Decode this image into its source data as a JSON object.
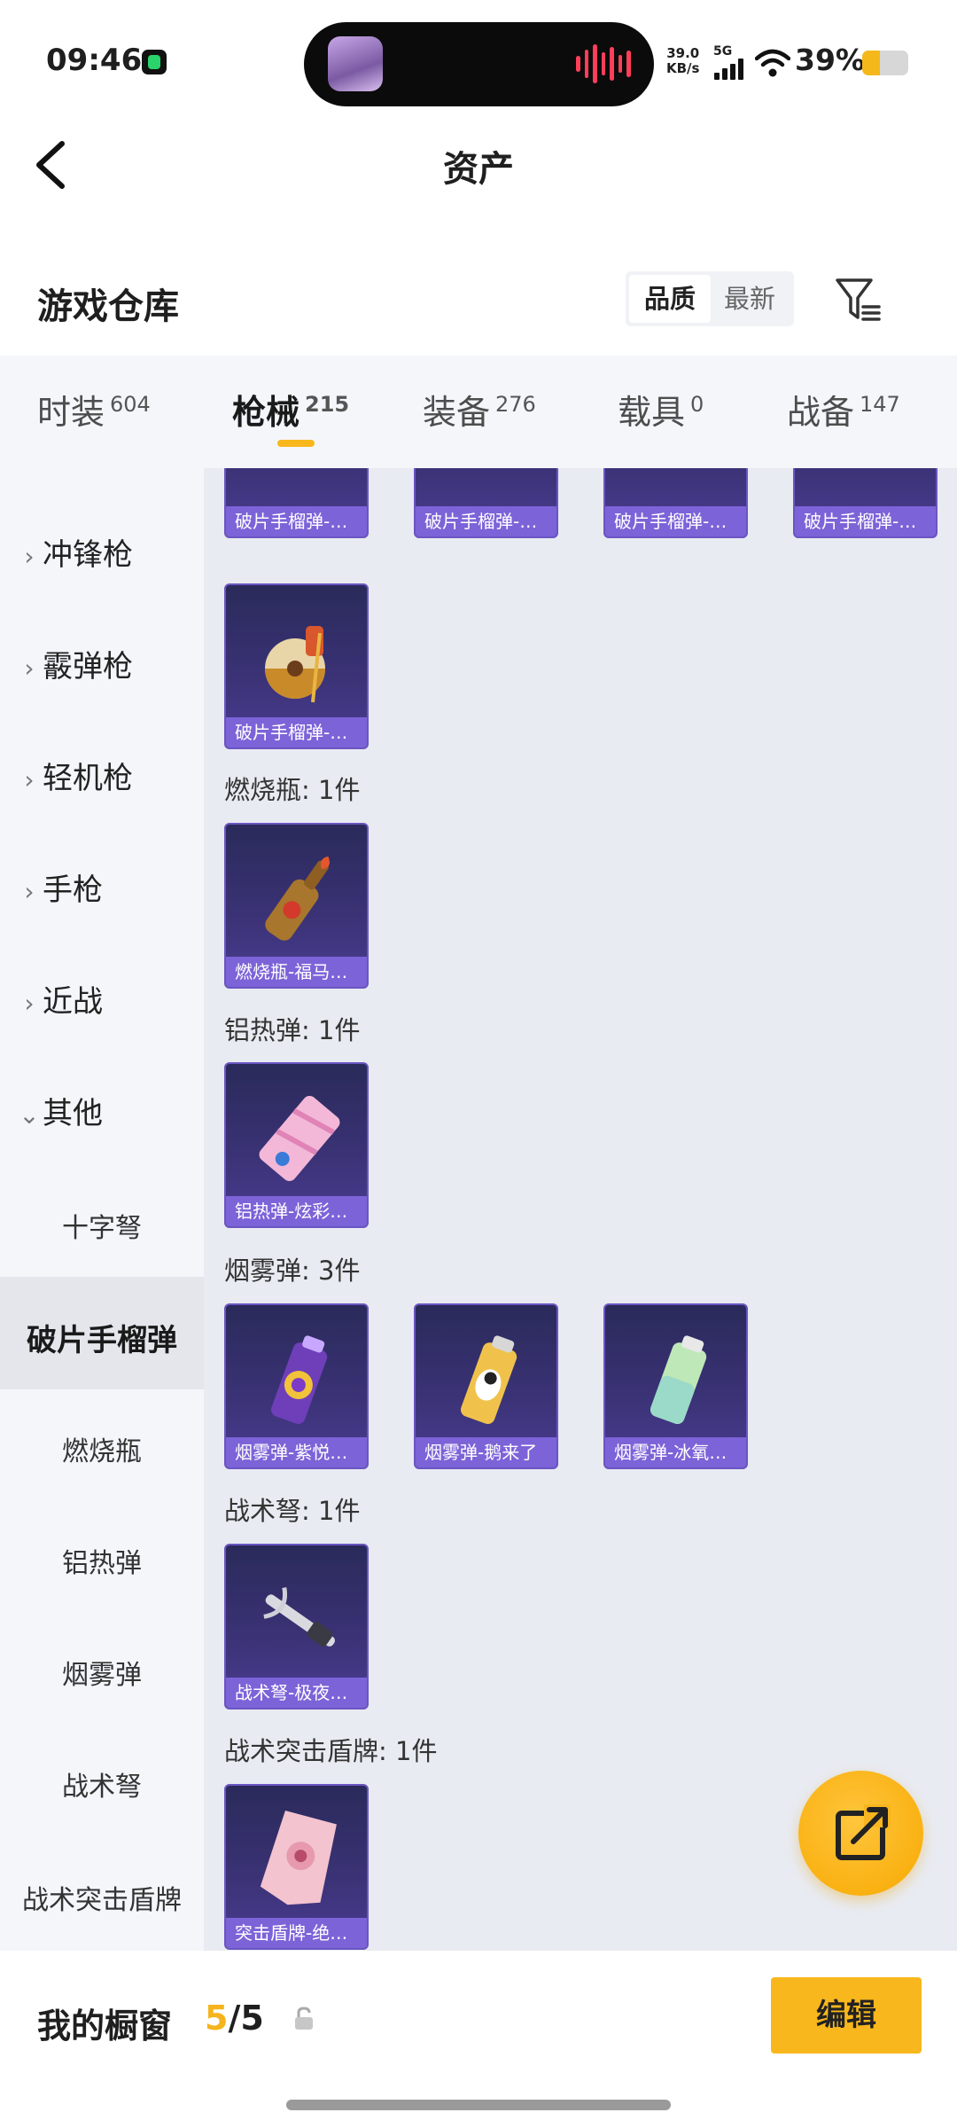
{
  "status": {
    "time": "09:46",
    "net_speed": "39.0",
    "net_speed_unit": "KB/s",
    "network": "5G",
    "battery_percent": "39%",
    "battery_level": 0.39
  },
  "header": {
    "title": "资产"
  },
  "warehouse": {
    "title": "游戏仓库",
    "sort_quality": "品质",
    "sort_latest": "最新"
  },
  "tabs": [
    {
      "label": "时装",
      "count": "604"
    },
    {
      "label": "枪械",
      "count": "215"
    },
    {
      "label": "装备",
      "count": "276"
    },
    {
      "label": "载具",
      "count": "0"
    },
    {
      "label": "战备",
      "count": "147"
    }
  ],
  "sidebar": {
    "categories": [
      "冲锋枪",
      "霰弹枪",
      "轻机枪",
      "手枪",
      "近战",
      "其他"
    ],
    "subcategories": [
      "十字弩",
      "破片手榴弹",
      "燃烧瓶",
      "铝热弹",
      "烟雾弹",
      "战术弩",
      "战术突击盾牌"
    ]
  },
  "content": {
    "top_cards": [
      "破片手榴弹-…",
      "破片手榴弹-…",
      "破片手榴弹-…",
      "破片手榴弹-…"
    ],
    "grenade_card": "破片手榴弹-…",
    "groups": [
      {
        "title": "燃烧瓶: 1件",
        "cards": [
          "燃烧瓶-福马…"
        ]
      },
      {
        "title": "铝热弹: 1件",
        "cards": [
          "铝热弹-炫彩…"
        ]
      },
      {
        "title": "烟雾弹: 3件",
        "cards": [
          "烟雾弹-紫悦…",
          "烟雾弹-鹅来了",
          "烟雾弹-冰氧…"
        ]
      },
      {
        "title": "战术弩: 1件",
        "cards": [
          "战术弩-极夜…"
        ]
      },
      {
        "title": "战术突击盾牌: 1件",
        "cards": [
          "突击盾牌-绝…"
        ]
      }
    ]
  },
  "bottom": {
    "showcase_label": "我的橱窗",
    "showcase_used": "5",
    "showcase_total": "/5",
    "edit_label": "编辑"
  },
  "colors": {
    "accent": "#f8b71c",
    "card_label": "#7d63d8",
    "card_bg": "#3a3275"
  }
}
